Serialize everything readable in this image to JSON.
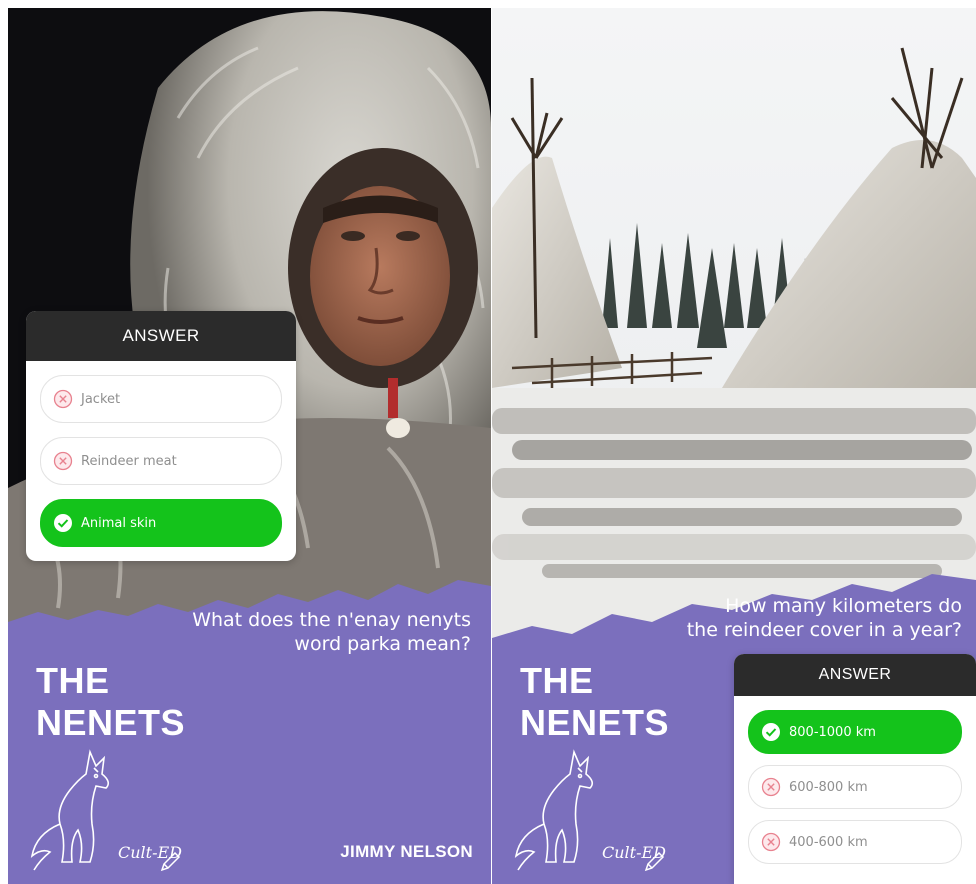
{
  "panels": [
    {
      "question": [
        "What does the n'enay nenyts",
        "word parka mean?"
      ],
      "brand_line1": "THE",
      "brand_line2": "NENETS",
      "logo_text": "Cult-ED",
      "author": "JIMMY NELSON",
      "answer_card": {
        "title": "ANSWER",
        "options": [
          {
            "label": "Jacket",
            "state": "wrong",
            "icon": "x-circle-icon"
          },
          {
            "label": "Reindeer meat",
            "state": "wrong",
            "icon": "x-circle-icon"
          },
          {
            "label": "Animal skin",
            "state": "correct",
            "icon": "check-circle-icon"
          }
        ]
      }
    },
    {
      "question": [
        "How many kilometers do",
        "the reindeer cover in a year?"
      ],
      "brand_line1": "THE",
      "brand_line2": "NENETS",
      "logo_text": "Cult-ED",
      "answer_card": {
        "title": "ANSWER",
        "options": [
          {
            "label": "800-1000 km",
            "state": "correct",
            "icon": "check-circle-icon"
          },
          {
            "label": "600-800 km",
            "state": "wrong",
            "icon": "x-circle-icon"
          },
          {
            "label": "400-600 km",
            "state": "wrong",
            "icon": "x-circle-icon"
          }
        ]
      }
    }
  ],
  "colors": {
    "purple": "#7b6fbd",
    "correct_green": "#14c31b",
    "wrong_pink": "#e8828f",
    "card_header": "#2b2b2b"
  }
}
